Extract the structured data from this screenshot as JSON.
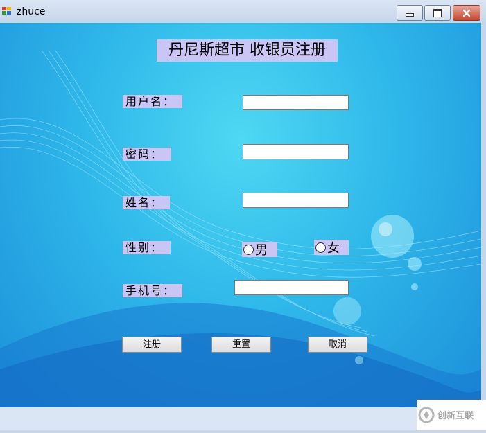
{
  "window": {
    "title": "zhuce"
  },
  "form": {
    "heading": "丹尼斯超市 收银员注册",
    "username_label": "用户名：",
    "password_label": "密码：",
    "name_label": "姓名：",
    "gender_label": "性别：",
    "phone_label": "手机号：",
    "username_value": "",
    "password_value": "",
    "name_value": "",
    "phone_value": "",
    "gender_options": [
      "男",
      "女"
    ]
  },
  "buttons": {
    "register": "注册",
    "reset": "重置",
    "cancel": "取消"
  },
  "watermark": {
    "brand": "创新互联"
  },
  "colors": {
    "label_bg": "#c9c6f5",
    "background": "#2fb8ea"
  }
}
